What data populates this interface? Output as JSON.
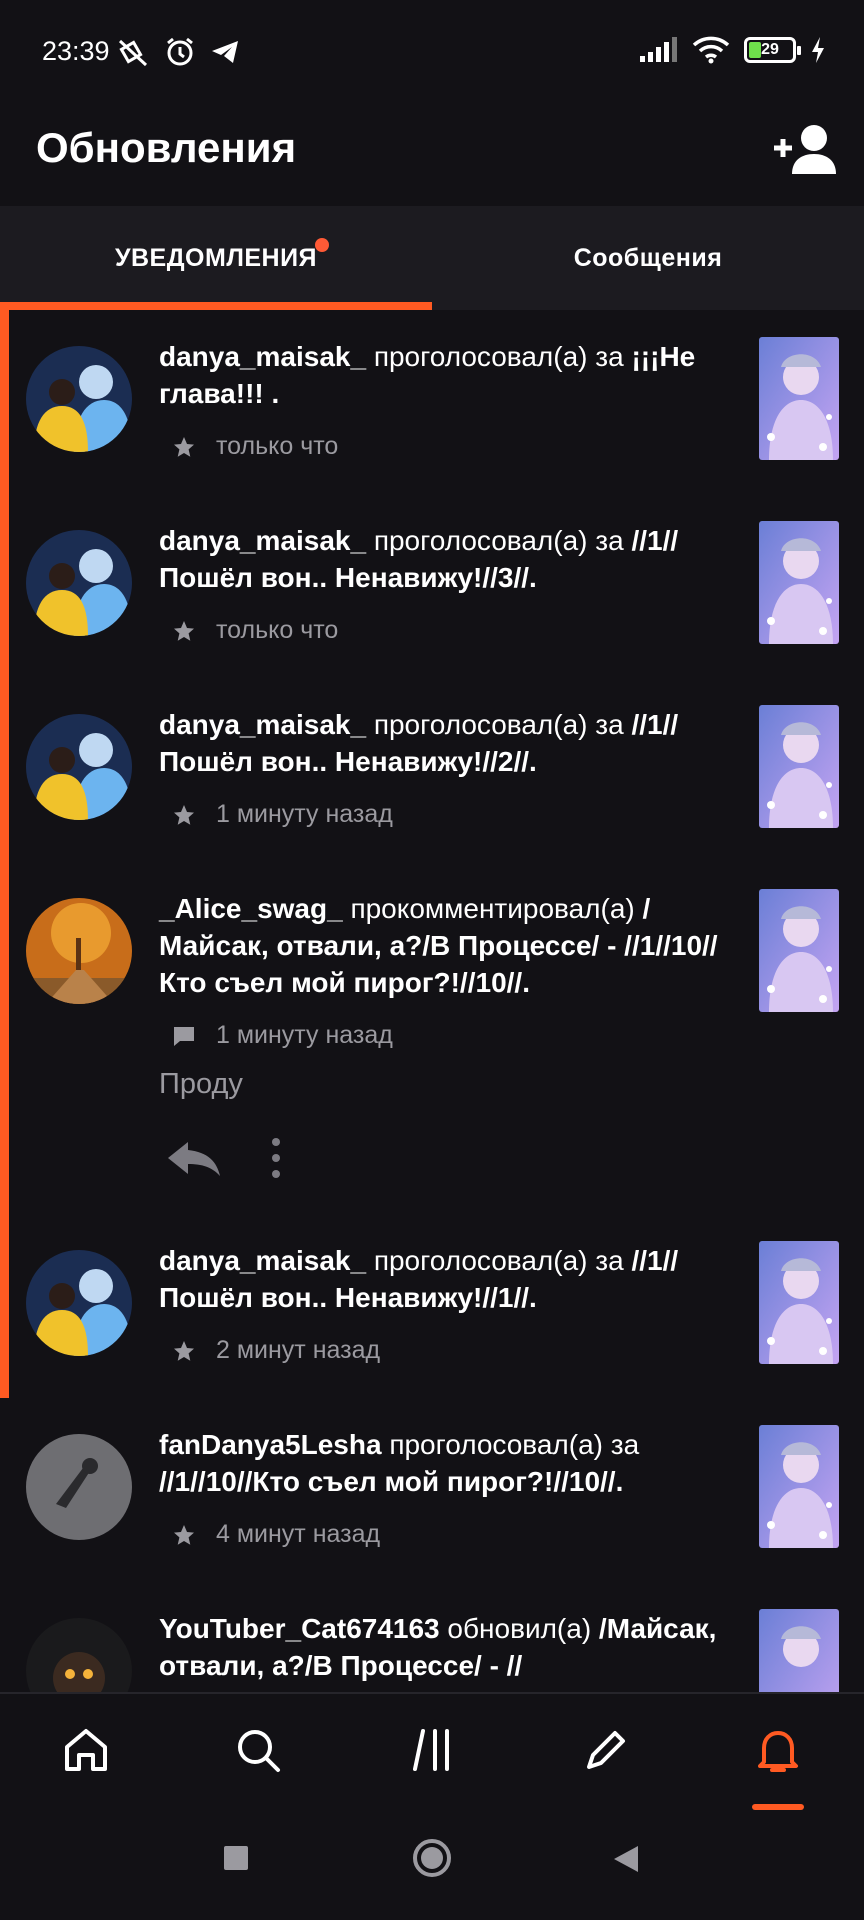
{
  "status_bar": {
    "time": "23:39",
    "battery_level": "29",
    "icons": [
      "mute-vibrate-icon",
      "alarm-icon",
      "telegram-icon",
      "signal-icon",
      "wifi-icon",
      "battery-icon",
      "charging-icon"
    ]
  },
  "header": {
    "title": "Обновления",
    "action_icon": "add-user-icon"
  },
  "tabs": [
    {
      "label": "УВЕДОМЛЕНИЯ",
      "selected": true,
      "has_badge": true
    },
    {
      "label": "Сообщения",
      "selected": false,
      "has_badge": false
    }
  ],
  "notifications": [
    {
      "user": "danya_maisak_",
      "action": " проголосовал(а) за ",
      "target": "¡¡¡Не глава!!! .",
      "time": "только что",
      "icon": "star-icon",
      "unread": true
    },
    {
      "user": "danya_maisak_",
      "action": " проголосовал(а) за ",
      "target": "//1//Пошёл вон.. Ненавижу!//3//.",
      "time": "только что",
      "icon": "star-icon",
      "unread": true
    },
    {
      "user": "danya_maisak_",
      "action": " проголосовал(а) за ",
      "target": "//1//Пошёл вон.. Ненавижу!//2//.",
      "time": "1 минуту назад",
      "icon": "star-icon",
      "unread": true
    },
    {
      "user": "_Alice_swag_",
      "action": " прокомментировал(а) ",
      "target": "/Майсак, отвали, а?/В Процессе/ - //1//10//Кто съел мой пирог?!//10//.",
      "time": "1 минуту назад",
      "icon": "comment-icon",
      "comment": "Проду",
      "unread": true
    },
    {
      "user": "danya_maisak_",
      "action": " проголосовал(а) за ",
      "target": "//1//Пошёл вон.. Ненавижу!//1//.",
      "time": "2 минут назад",
      "icon": "star-icon",
      "unread": true
    },
    {
      "user": "fanDanya5Lesha",
      "action": " проголосовал(а) за ",
      "target": "//1//10//Кто съел мой пирог?!//10//.",
      "time": "4 минут назад",
      "icon": "star-icon",
      "unread": false
    },
    {
      "user": "YouTuber_Cat674163",
      "action": " обновил(а) ",
      "target": "/Майсак, отвали, а?/В Процессе/ - //",
      "time": "",
      "icon": "",
      "unread": false
    }
  ],
  "bottom_nav": [
    {
      "name": "home-icon",
      "active": false
    },
    {
      "name": "search-icon",
      "active": false
    },
    {
      "name": "library-icon",
      "active": false
    },
    {
      "name": "write-icon",
      "active": false
    },
    {
      "name": "bell-icon",
      "active": true
    }
  ],
  "colors": {
    "background": "#121115",
    "tab_bar": "#1c1b20",
    "accent": "#ff5a22",
    "secondary_text": "#9b9aa0"
  }
}
